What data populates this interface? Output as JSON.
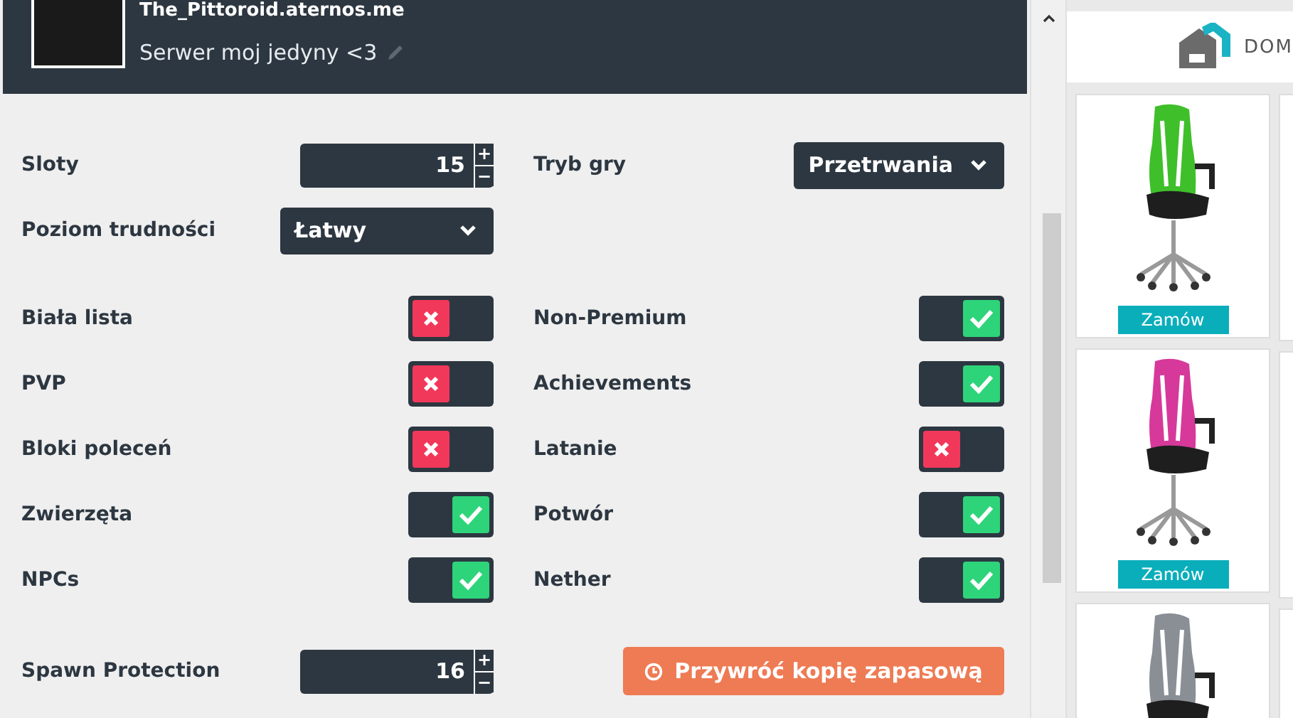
{
  "header": {
    "title": "The_Pittoroid.aternos.me",
    "description": "Serwer moj jedyny <3"
  },
  "top": [
    {
      "kind": "number",
      "label": "Sloty",
      "value": "15",
      "plus": "+",
      "minus": "−"
    },
    {
      "kind": "select",
      "label": "Tryb gry",
      "value": "Przetrwania"
    },
    {
      "kind": "select",
      "label": "Poziom trudności",
      "value": "Łatwy"
    }
  ],
  "toggles": [
    {
      "label": "Biała lista",
      "on": false
    },
    {
      "label": "Non-Premium",
      "on": true
    },
    {
      "label": "PVP",
      "on": false
    },
    {
      "label": "Achievements",
      "on": true
    },
    {
      "label": "Bloki poleceń",
      "on": false
    },
    {
      "label": "Latanie",
      "on": false
    },
    {
      "label": "Zwierzęta",
      "on": true
    },
    {
      "label": "Potwór",
      "on": true
    },
    {
      "label": "NPCs",
      "on": true
    },
    {
      "label": "Nether",
      "on": true
    }
  ],
  "bottom": [
    {
      "kind": "number",
      "label": "Spawn Protection",
      "value": "16",
      "plus": "+",
      "minus": "−"
    },
    {
      "kind": "button",
      "label": "Przywróć kopię zapasową"
    }
  ],
  "ad": {
    "brand": "DOM",
    "products": [
      {
        "color": "#3fbf2a",
        "button": "Zamów"
      },
      {
        "color": "#d6399a",
        "button": "Zamów"
      },
      {
        "color": "#8a8f96"
      }
    ]
  }
}
